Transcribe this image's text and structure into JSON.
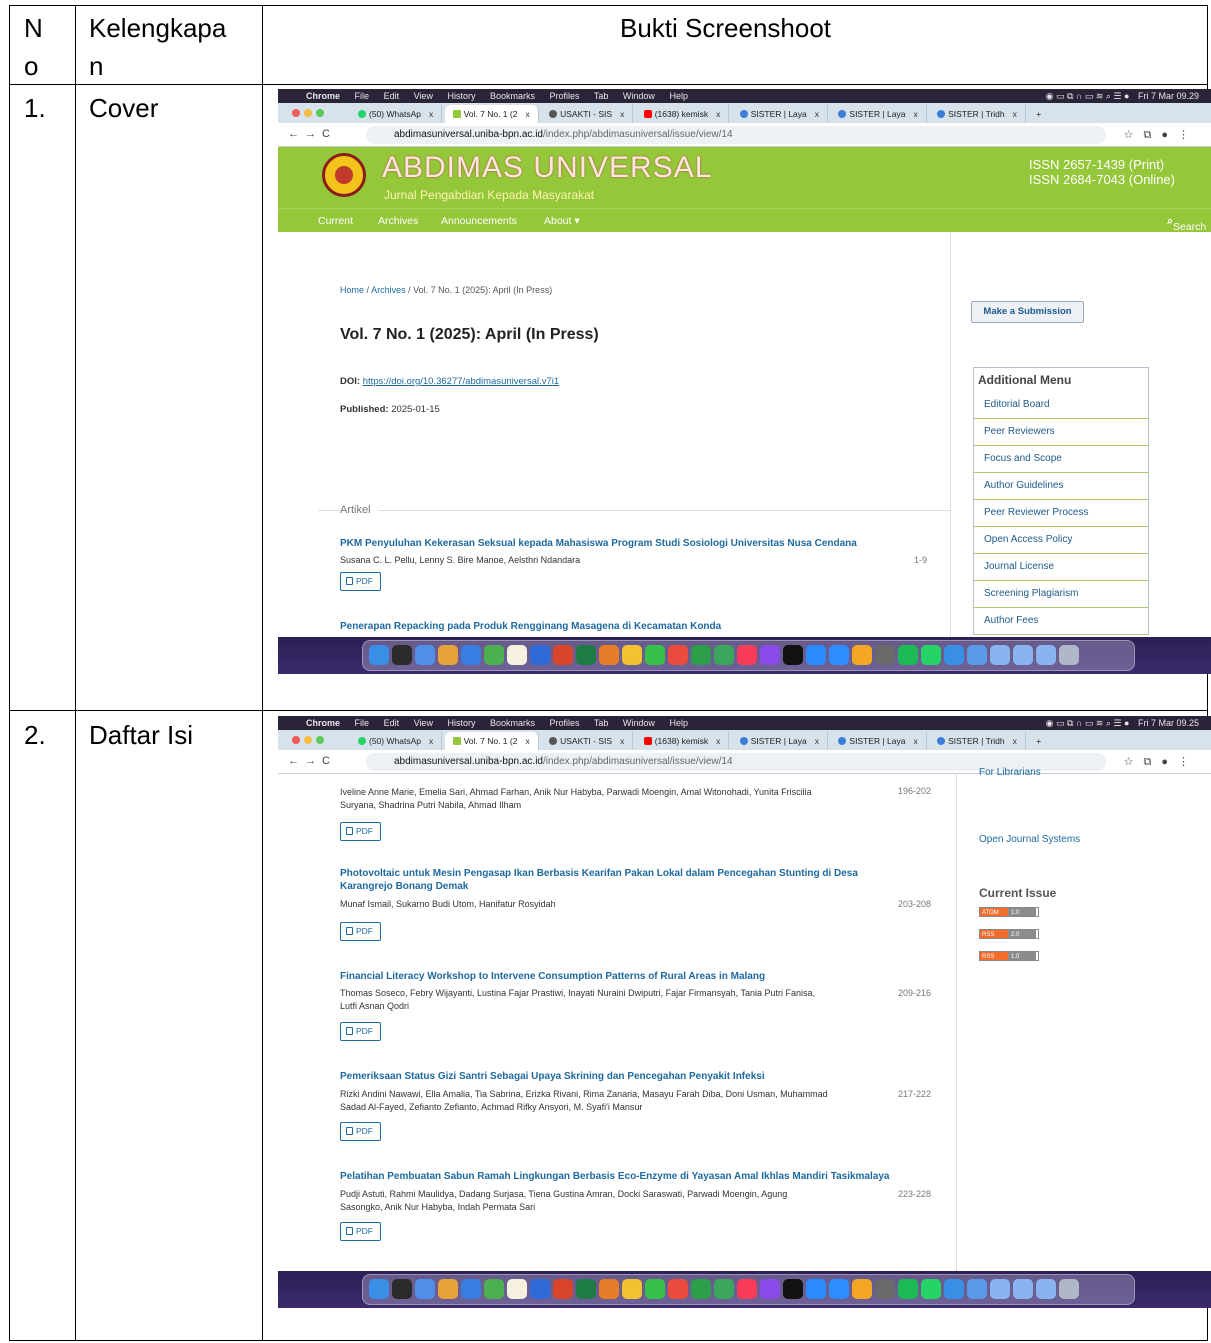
{
  "table": {
    "headers": {
      "no": "No",
      "no_line1": "N",
      "no_line2": "o",
      "kelengkapan_line1": "Kelengkapa",
      "kelengkapan_line2": "n",
      "bukti": "Bukti Screenshoot"
    },
    "rows": [
      {
        "no": "1.",
        "kelengkapan": "Cover"
      },
      {
        "no": "2.",
        "kelengkapan": "Daftar Isi"
      }
    ]
  },
  "mac_menubar": {
    "app": "Chrome",
    "items": [
      "File",
      "Edit",
      "View",
      "History",
      "Bookmarks",
      "Profiles",
      "Tab",
      "Window",
      "Help"
    ],
    "clock_1": "Fri 7 Mar 09.29",
    "clock_2": "Fri 7 Mar 09.25"
  },
  "browser": {
    "tabs": [
      {
        "label": "(50) WhatsAp",
        "color": "#25d366"
      },
      {
        "label": "Vol. 7 No. 1 (2",
        "color": "#94c83a"
      },
      {
        "label": "USAKTI - SIS",
        "color": "#555555"
      },
      {
        "label": "(1638) kemisk",
        "color": "#ff0000"
      },
      {
        "label": "SISTER | Laya",
        "color": "#3b7dd8"
      },
      {
        "label": "SISTER | Laya",
        "color": "#3b7dd8"
      },
      {
        "label": "SISTER | Tridh",
        "color": "#3b7dd8"
      }
    ],
    "new_tab": "+",
    "url_host": "abdimasuniversal.uniba-bpn.ac.id",
    "url_path": "/index.php/abdimasuniversal/issue/view/14"
  },
  "site": {
    "title": "ABDIMAS UNIVERSAL",
    "subtitle": "Jurnal Pengabdian Kepada Masyarakat",
    "issn_print": "ISSN 2657-1439 (Print)",
    "issn_online": "ISSN 2684-7043 (Online)",
    "nav": [
      "Current",
      "Archives",
      "Announcements",
      "About ▾"
    ],
    "search": "Search"
  },
  "issue": {
    "breadcrumb_home": "Home",
    "breadcrumb_archives": "Archives",
    "breadcrumb_current": "Vol. 7 No. 1 (2025): April (In Press)",
    "sep": "/",
    "title": "Vol. 7 No. 1 (2025): April (In Press)",
    "doi_label": "DOI:",
    "doi_url": "https://doi.org/10.36277/abdimasuniversal.v7i1",
    "published_label": "Published:",
    "published_date": "2025-01-15",
    "section": "Artikel"
  },
  "sidebar": {
    "submit": "Make a Submission",
    "menu_title": "Additional Menu",
    "menu_items": [
      "Editorial Board",
      "Peer Reviewers",
      "Focus and Scope",
      "Author Guidelines",
      "Peer Reviewer Process",
      "Open Access Policy",
      "Journal License",
      "Screening Plagiarism",
      "Author Fees"
    ],
    "for_librarians": "For Librarians",
    "ojs": "Open Journal Systems",
    "current_issue": "Current Issue",
    "feeds": [
      {
        "left": "ATOM",
        "right": "1.0"
      },
      {
        "left": "RSS",
        "right": "2.0"
      },
      {
        "left": "RSS",
        "right": "1.0"
      }
    ]
  },
  "pdf_label": "PDF",
  "articles_1": [
    {
      "title": "PKM Penyuluhan Kekerasan Seksual kepada Mahasiswa Program Studi Sosiologi Universitas Nusa Cendana",
      "authors": "Susana C. L. Pellu, Lenny S. Bire Manoe, Aelsthri Ndandara",
      "pages": "1-9"
    },
    {
      "title": "Penerapan Repacking pada Produk Rengginang Masagena di Kecamatan Konda"
    }
  ],
  "articles_2": [
    {
      "authors_1": "Iveline Anne Marie, Emelia Sari, Ahmad Farhan, Anik Nur Habyba, Parwadi Moengin, Amal Witonohadi, Yunita Friscilia",
      "authors_2": "Suryana, Shadrina Putri Nabila, Ahmad Ilham",
      "pages": "196-202"
    },
    {
      "title_1": "Photovoltaic untuk Mesin Pengasap Ikan Berbasis Kearifan Pakan Lokal dalam Pencegahan Stunting di Desa",
      "title_2": "Karangrejo Bonang Demak",
      "authors_1": "Munaf Ismail, Sukarno Budi Utom, Hanifatur Rosyidah",
      "pages": "203-208"
    },
    {
      "title_1": "Financial Literacy Workshop to Intervene Consumption Patterns of Rural Areas in Malang",
      "authors_1": "Thomas Soseco, Febry Wijayanti, Lustina Fajar Prastiwi, Inayati Nuraini Dwiputri, Fajar Firmansyah, Tania Putri Fanisa,",
      "authors_2": "Lutfi Asnan Qodri",
      "pages": "209-216"
    },
    {
      "title_1": "Pemeriksaan Status Gizi Santri Sebagai Upaya Skrining dan Pencegahan Penyakit Infeksi",
      "authors_1": "Rizki Andini Nawawi, Ella Amalia, Tia Sabrina, Erizka Rivani, Rima Zanaria, Masayu Farah Diba, Doni Usman, Muhammad",
      "authors_2": "Sadad Al-Fayed, Zefianto Zefianto, Achmad Rifky Ansyori, M. Syafi'i Mansur",
      "pages": "217-222"
    },
    {
      "title_1": "Pelatihan Pembuatan Sabun Ramah Lingkungan Berbasis Eco-Enzyme di Yayasan Amal Ikhlas Mandiri Tasikmalaya",
      "authors_1": "Pudji Astuti, Rahmi Maulidya, Dadang Surjasa, Tiena Gustina Amran, Docki Saraswati, Parwadi Moengin, Agung",
      "authors_2": "Sasongko, Anik Nur Habyba, Indah Permata Sari",
      "pages": "223-228"
    }
  ],
  "colors": {
    "site_green": "#94c83a",
    "link_blue": "#1e6aa0",
    "dock_purple": "#2c1f55"
  }
}
